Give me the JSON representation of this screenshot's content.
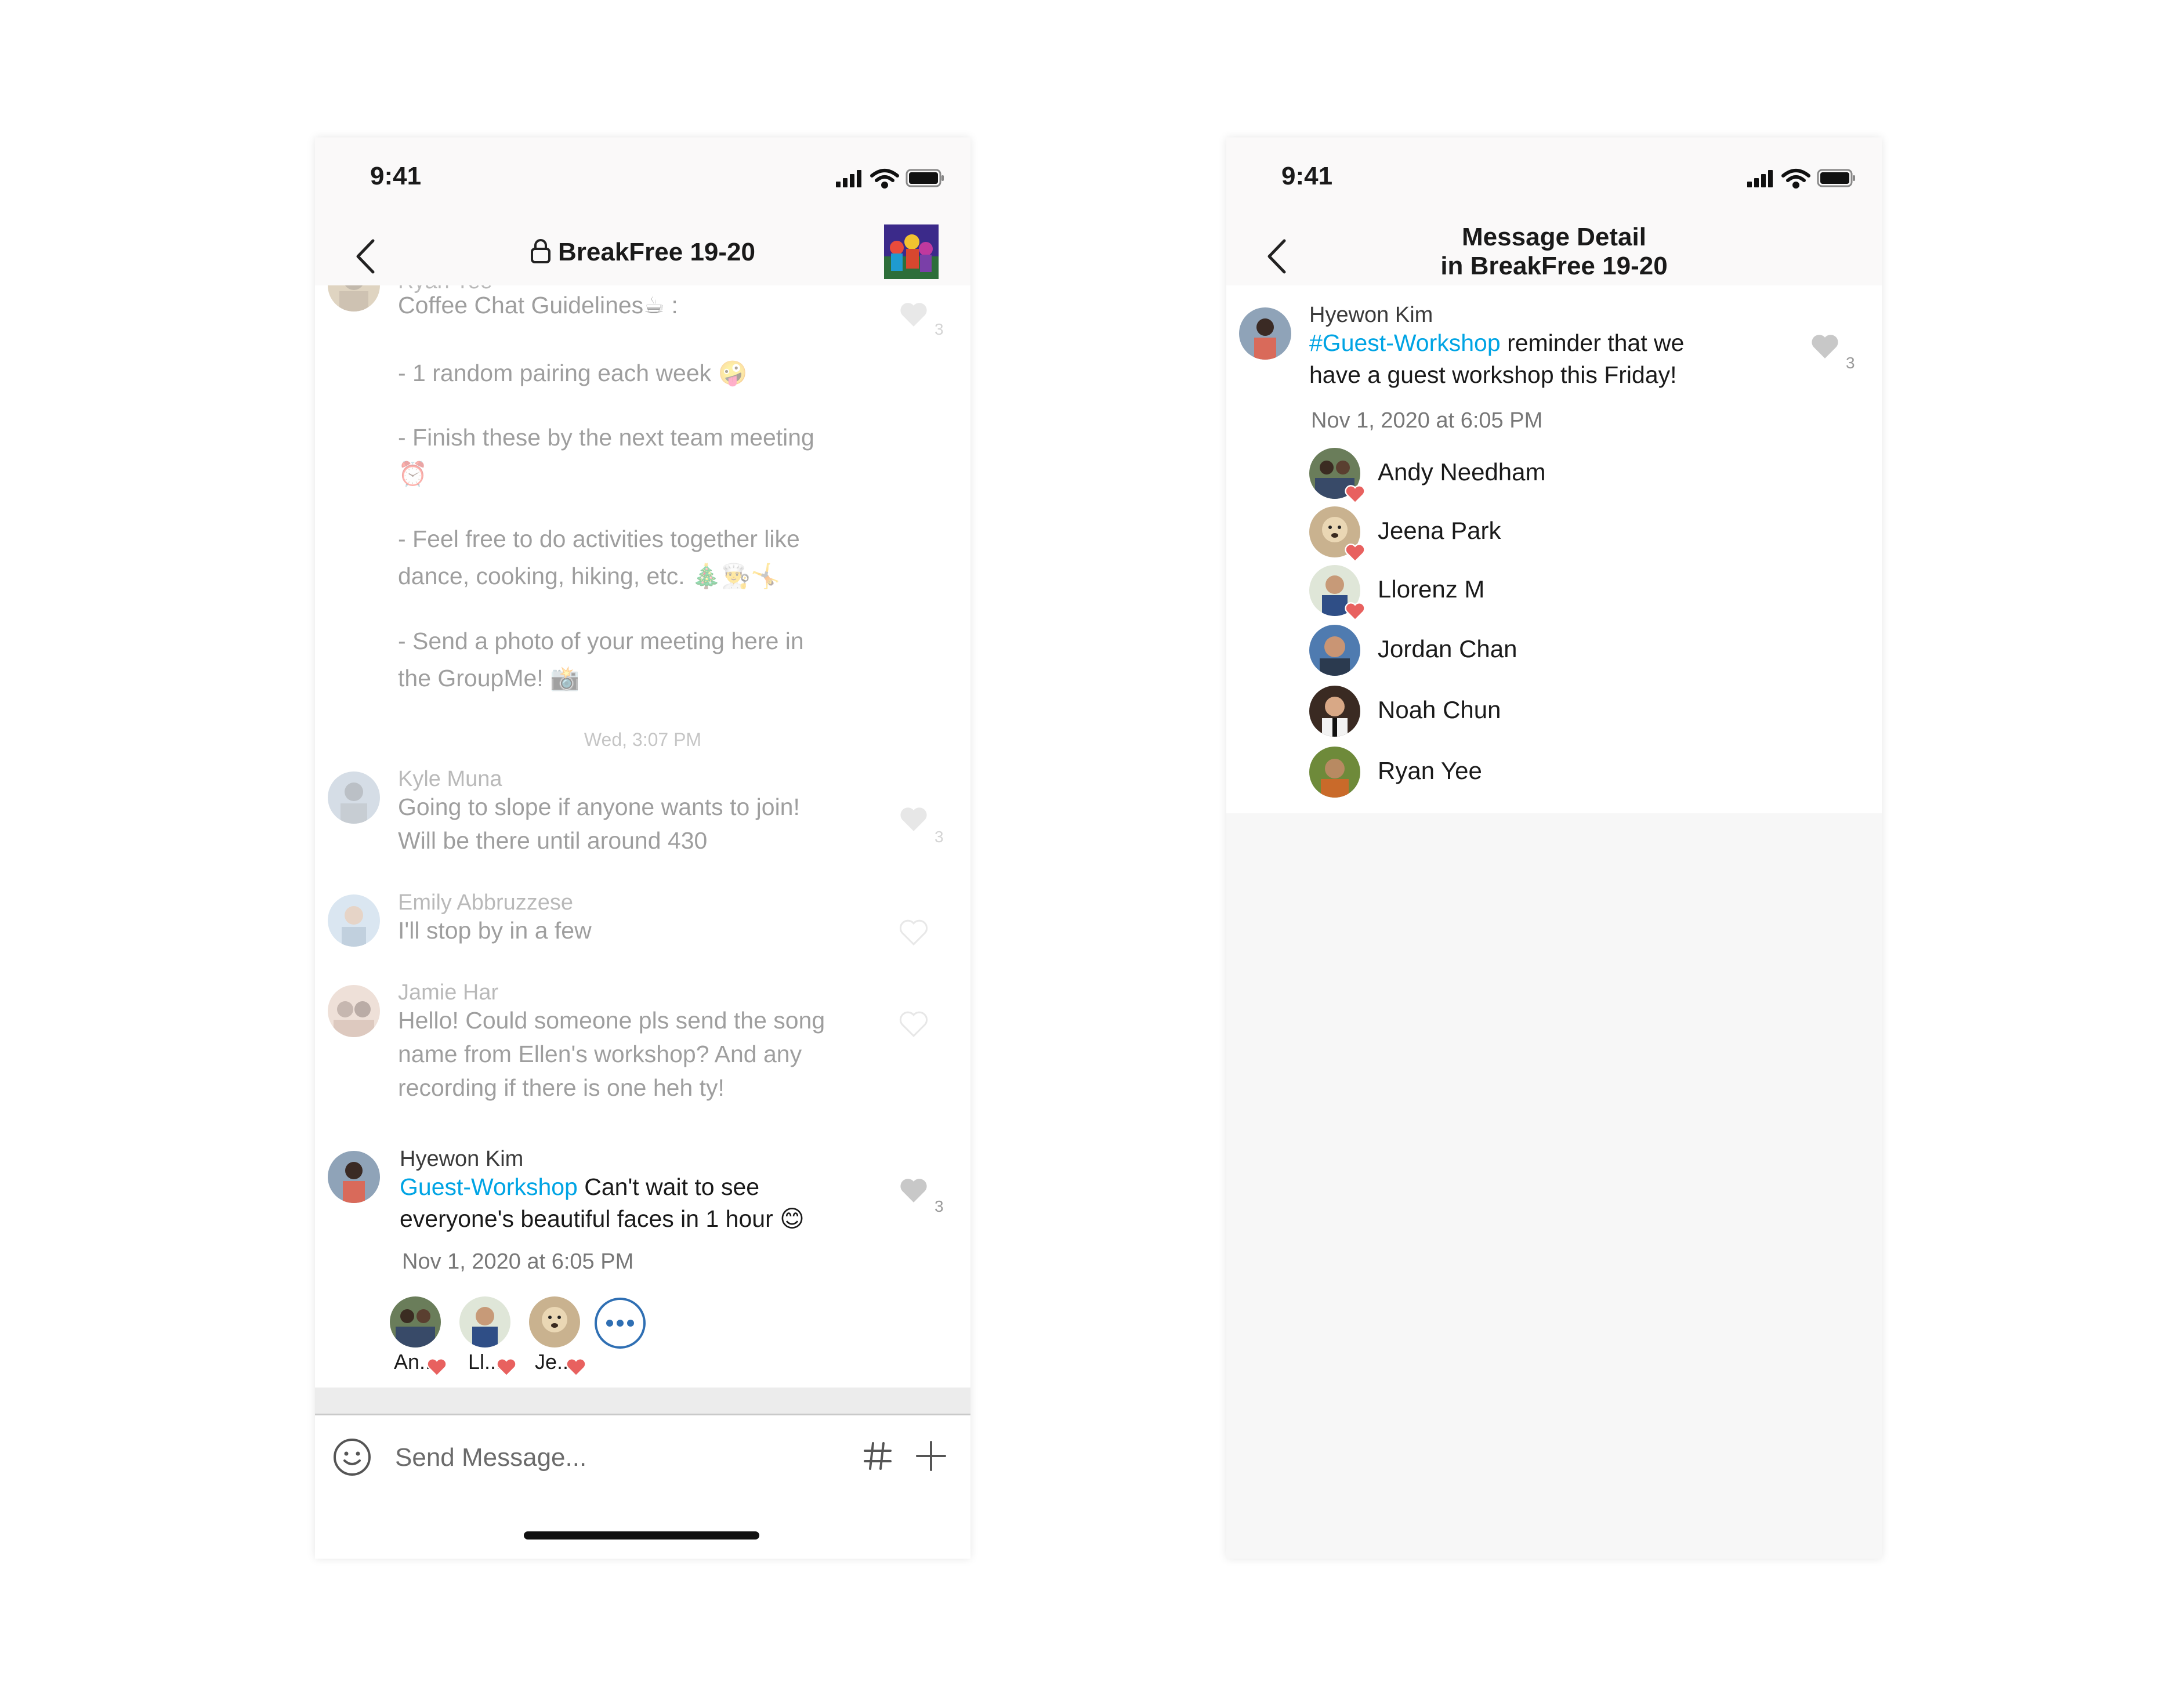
{
  "left_screen": {
    "status_time": "9:41",
    "title": "BreakFree 19-20",
    "feed": {
      "partial_sender": "Ryan Yee",
      "guidelines": {
        "l1": "Coffee Chat Guidelines☕ :",
        "l2": "- 1 random pairing each week 🤪",
        "l3": "- Finish these by the next team meeting",
        "l3b": "⏰",
        "l4": "- Feel free to do activities together like",
        "l4b": "dance, cooking, hiking, etc. 🎄👨‍🍳🤸",
        "l5": "- Send a photo of your meeting here in",
        "l5b": "the GroupMe! 📸",
        "like_count": "3"
      },
      "separator_time": "Wed, 3:07 PM",
      "messages": [
        {
          "sender": "Kyle Muna",
          "text": "Going to slope if anyone wants to join!\nWill be there until around 430",
          "like_count": "3"
        },
        {
          "sender": "Emily Abbruzzese",
          "text": "I'll stop by in a few",
          "like_count": ""
        },
        {
          "sender": "Jamie Har",
          "text": "Hello! Could someone pls send the song\nname from Ellen's workshop? And any\nrecording if there is one heh ty!",
          "like_count": ""
        }
      ],
      "focused": {
        "sender": "Hyewon Kim",
        "hashtag": "Guest-Workshop",
        "text_1": " Can't wait to see",
        "text_2": "everyone's beautiful faces in 1 hour 😊",
        "like_count": "3",
        "timestamp": "Nov 1, 2020 at 6:05 PM",
        "likers": [
          "An...",
          "Ll...",
          "Je..."
        ]
      }
    },
    "composer": {
      "placeholder": "Send Message..."
    }
  },
  "right_screen": {
    "status_time": "9:41",
    "title_line1": "Message Detail",
    "title_line2": "in BreakFree 19-20",
    "message": {
      "sender": "Hyewon Kim",
      "hashtag": "#Guest-Workshop",
      "text_1": " reminder that we",
      "text_2": "have a guest workshop this Friday!",
      "like_count": "3",
      "timestamp": "Nov 1, 2020 at 6:05 PM"
    },
    "likers": [
      "Andy Needham",
      "Jeena Park",
      "Llorenz M",
      "Jordan Chan",
      "Noah Chun",
      "Ryan Yee"
    ]
  },
  "colors": {
    "hashtag": "#00a4e4",
    "heart": "#e8615f",
    "like_gray": "#c8c8c8",
    "more_blue": "#2f6fb3"
  },
  "icons": [
    "back-chevron-icon",
    "lock-icon",
    "heart-icon",
    "smiley-icon",
    "hashtag-icon",
    "plus-icon",
    "signal-icon",
    "wifi-icon",
    "battery-icon",
    "more-dots-icon"
  ]
}
